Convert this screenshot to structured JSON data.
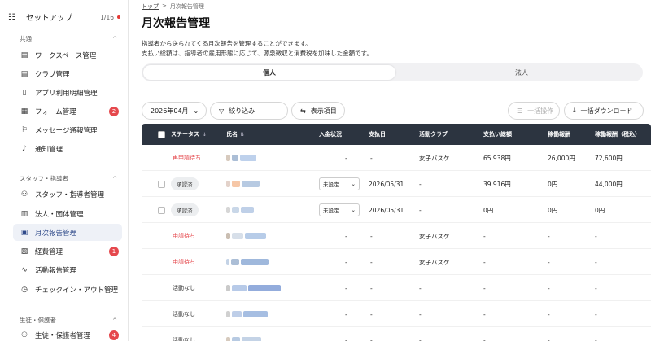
{
  "sidebar": {
    "setup": {
      "label": "セットアップ",
      "count": "1/16",
      "icon": "checklist-icon"
    },
    "sections": [
      {
        "title": "共通"
      },
      {
        "title": "スタッフ・指導者"
      },
      {
        "title": "生徒・保護者"
      }
    ],
    "items": [
      {
        "label": "ワークスペース管理",
        "icon": "book-icon"
      },
      {
        "label": "クラブ管理",
        "icon": "book-icon"
      },
      {
        "label": "アプリ利用明細管理",
        "icon": "document-icon"
      },
      {
        "label": "フォーム管理",
        "icon": "form-icon",
        "badge": "2"
      },
      {
        "label": "メッセージ通報管理",
        "icon": "flag-icon"
      },
      {
        "label": "通知管理",
        "icon": "bell-icon"
      },
      {
        "label": "スタッフ・指導者管理",
        "icon": "users-icon"
      },
      {
        "label": "法人・団体管理",
        "icon": "building-icon"
      },
      {
        "label": "月次報告管理",
        "icon": "calendar-icon",
        "active": true
      },
      {
        "label": "経費管理",
        "icon": "receipt-icon",
        "badge": "1"
      },
      {
        "label": "活動報告管理",
        "icon": "activity-icon"
      },
      {
        "label": "チェックイン・アウト管理",
        "icon": "clock-icon"
      },
      {
        "label": "生徒・保護者管理",
        "icon": "users-icon",
        "badge": "4"
      }
    ]
  },
  "breadcrumb": {
    "home": "トップ",
    "sep": ">",
    "current": "月次報告管理"
  },
  "page": {
    "title": "月次報告管理",
    "desc1": "指導者から送られてくる月次報告を管理することができます。",
    "desc2": "支払い総額は、指導者の雇用形態に応じて、源泉徴収と消費税を加味した金額です。"
  },
  "tabs": [
    "個人",
    "法人"
  ],
  "toolbar": {
    "month": "2026年04月",
    "filter": "絞り込み",
    "columns": "表示項目",
    "bulk": "一括操作",
    "download": "一括ダウンロード"
  },
  "table": {
    "headers": {
      "status": "ステータス",
      "name": "氏名",
      "payment_status": "入金状況",
      "pay_date": "支払日",
      "club": "活動クラブ",
      "total": "支払い総額",
      "fee": "稼働報酬",
      "fee_tax": "稼働報酬（税込）"
    },
    "rows": [
      {
        "status": "再申請待ち",
        "style": "red",
        "checkbox": false,
        "select": "",
        "payment": "-",
        "pay_date": "-",
        "club": "女子バスケ",
        "total": "65,938円",
        "fee": "26,000円",
        "fee_tax": "72,600円"
      },
      {
        "status": "承認済",
        "style": "pill",
        "checkbox": true,
        "select": "未設定",
        "payment": "",
        "pay_date": "2026/05/31",
        "club": "-",
        "total": "39,916円",
        "fee": "0円",
        "fee_tax": "44,000円"
      },
      {
        "status": "承認済",
        "style": "pill",
        "checkbox": true,
        "select": "未設定",
        "payment": "",
        "pay_date": "2026/05/31",
        "club": "-",
        "total": "0円",
        "fee": "0円",
        "fee_tax": "0円"
      },
      {
        "status": "申請待ち",
        "style": "red",
        "checkbox": false,
        "select": "",
        "payment": "-",
        "pay_date": "-",
        "club": "女子バスケ",
        "total": "-",
        "fee": "-",
        "fee_tax": "-"
      },
      {
        "status": "申請待ち",
        "style": "red",
        "checkbox": false,
        "select": "",
        "payment": "-",
        "pay_date": "-",
        "club": "女子バスケ",
        "total": "-",
        "fee": "-",
        "fee_tax": "-"
      },
      {
        "status": "活動なし",
        "style": "gray",
        "checkbox": false,
        "select": "",
        "payment": "-",
        "pay_date": "-",
        "club": "-",
        "total": "-",
        "fee": "-",
        "fee_tax": "-"
      },
      {
        "status": "活動なし",
        "style": "gray",
        "checkbox": false,
        "select": "",
        "payment": "-",
        "pay_date": "-",
        "club": "-",
        "total": "-",
        "fee": "-",
        "fee_tax": "-"
      },
      {
        "status": "活動なし",
        "style": "gray",
        "checkbox": false,
        "select": "",
        "payment": "-",
        "pay_date": "-",
        "club": "-",
        "total": "-",
        "fee": "-",
        "fee_tax": "-"
      }
    ]
  },
  "colors": {
    "accent": "#2f4a8a",
    "header_bg": "#2c3440",
    "badge": "#e5484d",
    "status_red": "#e5484d"
  }
}
